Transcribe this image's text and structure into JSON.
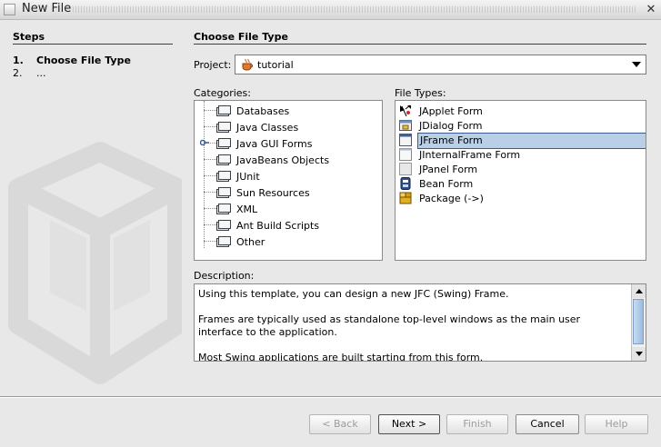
{
  "window": {
    "title": "New File",
    "close_glyph": "✕"
  },
  "steps": {
    "title": "Steps",
    "items": [
      {
        "num": "1.",
        "label": "Choose File Type"
      },
      {
        "num": "2.",
        "label": "..."
      }
    ]
  },
  "main": {
    "title": "Choose File Type",
    "project": {
      "label": "Project:",
      "value": "tutorial",
      "icon": "coffee-cup-icon"
    },
    "categories": {
      "label": "Categories:",
      "items": [
        "Databases",
        "Java Classes",
        "Java GUI Forms",
        "JavaBeans Objects",
        "JUnit",
        "Sun Resources",
        "XML",
        "Ant Build Scripts",
        "Other"
      ],
      "selected": "Java GUI Forms"
    },
    "file_types": {
      "label": "File Types:",
      "items": [
        {
          "label": "JApplet Form",
          "icon": "applet-icon"
        },
        {
          "label": "JDialog Form",
          "icon": "dialog-icon"
        },
        {
          "label": "JFrame Form",
          "icon": "frame-icon"
        },
        {
          "label": "JInternalFrame Form",
          "icon": "internal-frame-icon"
        },
        {
          "label": "JPanel Form",
          "icon": "panel-icon"
        },
        {
          "label": "Bean Form",
          "icon": "bean-icon"
        },
        {
          "label": "Package (->)",
          "icon": "package-icon"
        }
      ],
      "selected": "JFrame Form"
    },
    "description": {
      "label": "Description:",
      "paragraphs": [
        "Using this template, you can design a new JFC (Swing) Frame.",
        "Frames are typically used as standalone top-level windows as the main user interface to the application.",
        "Most Swing applications are built starting from this form."
      ]
    }
  },
  "buttons": {
    "back": "< Back",
    "next": "Next >",
    "finish": "Finish",
    "cancel": "Cancel",
    "help": "Help"
  },
  "colors": {
    "selection_bg": "#b8cfe5",
    "selection_border": "#3c5c8c",
    "background": "#e8e8e8",
    "disabled_text": "#9c9c9c"
  }
}
